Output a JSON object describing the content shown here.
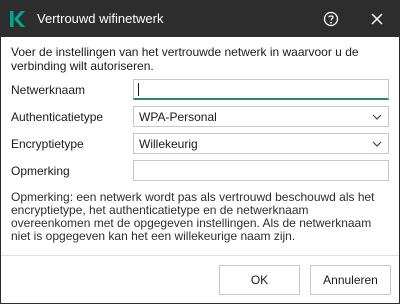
{
  "window": {
    "title": "Vertrouwd wifinetwerk",
    "icons": {
      "logo": "kaspersky-k-logo",
      "help": "help-icon",
      "close": "close-icon"
    },
    "colors": {
      "titlebar": "#2d2d2d",
      "logo": "#00a88e",
      "focus": "#2b8a6e"
    }
  },
  "intro": "Voer de instellingen van het vertrouwde netwerk in waarvoor u de verbinding wilt autoriseren.",
  "form": {
    "network_name": {
      "label": "Netwerknaam",
      "value": "",
      "placeholder": ""
    },
    "auth_type": {
      "label": "Authenticatietype",
      "value": "WPA-Personal"
    },
    "encryption_type": {
      "label": "Encryptietype",
      "value": "Willekeurig"
    },
    "remark": {
      "label": "Opmerking",
      "value": "",
      "placeholder": ""
    }
  },
  "note": "Opmerking: een netwerk wordt pas als vertrouwd beschouwd als het encryptietype, het authenticatietype en de netwerknaam overeenkomen met de opgegeven instellingen. Als de netwerknaam niet is opgegeven kan het een willekeurige naam zijn.",
  "buttons": {
    "ok": "OK",
    "cancel": "Annuleren"
  }
}
